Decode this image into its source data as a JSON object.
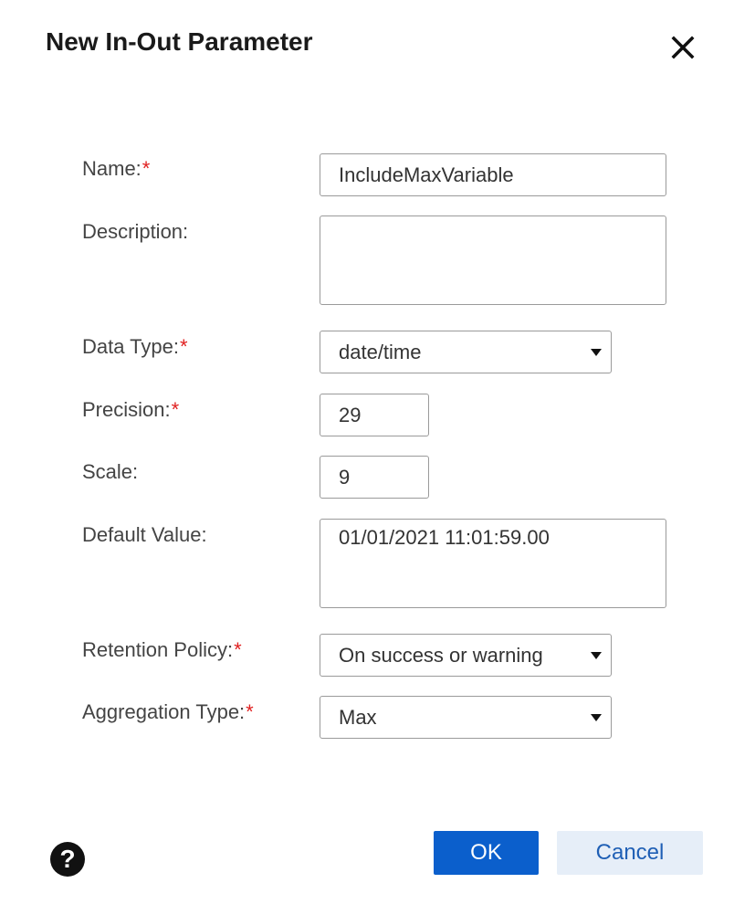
{
  "dialog": {
    "title": "New In-Out Parameter"
  },
  "form": {
    "name": {
      "label": "Name:",
      "required": "*",
      "value": "IncludeMaxVariable"
    },
    "description": {
      "label": "Description:",
      "value": ""
    },
    "data_type": {
      "label": "Data Type:",
      "required": "*",
      "value": "date/time"
    },
    "precision": {
      "label": "Precision:",
      "required": "*",
      "value": "29"
    },
    "scale": {
      "label": "Scale:",
      "value": "9"
    },
    "default_value": {
      "label": "Default Value:",
      "value": "01/01/2021 11:01:59.00"
    },
    "retention_policy": {
      "label": "Retention Policy:",
      "required": "*",
      "value": "On success or warning"
    },
    "aggregation_type": {
      "label": "Aggregation Type:",
      "required": "*",
      "value": "Max"
    }
  },
  "footer": {
    "help_glyph": "?",
    "ok_label": "OK",
    "cancel_label": "Cancel"
  },
  "icons": {
    "close": "close-icon",
    "help": "help-icon",
    "dropdown": "caret-down-icon"
  },
  "colors": {
    "required_marker": "#e02020",
    "primary_button": "#0b5fcc",
    "secondary_button_bg": "#e6eef8",
    "secondary_button_text": "#1f5fb5"
  }
}
